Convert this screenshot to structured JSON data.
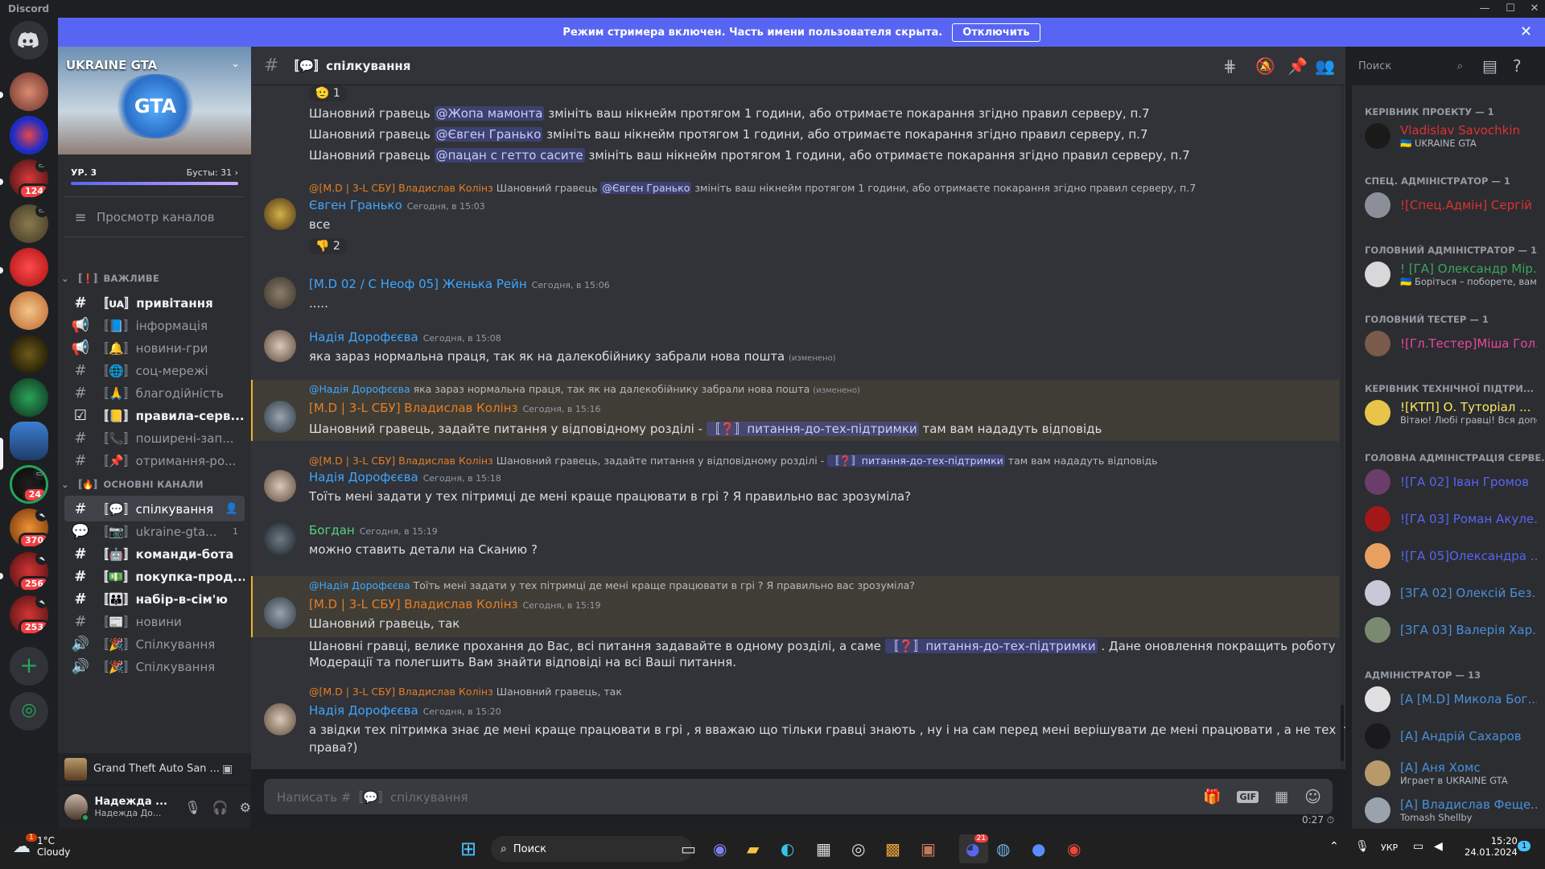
{
  "app": {
    "title": "Discord"
  },
  "banner": {
    "text": "Режим стримера включен. Часть имени пользователя скрыта.",
    "button": "Отключить"
  },
  "servers": {
    "badges": [
      "124",
      "24",
      "370",
      "256",
      "253"
    ]
  },
  "guild": {
    "name": "UKRAINE GTA",
    "level": "УР. 3",
    "boosts": "Бусты: 31",
    "browse": "Просмотр каналов"
  },
  "categories": {
    "important": "〚❗〛ВАЖЛИВЕ",
    "main": "〚🔥〛ОСНОВНІ КАНАЛИ"
  },
  "channels": [
    {
      "name": "〚ᴜᴀ〛привітання"
    },
    {
      "name": "〚📘〛інформація"
    },
    {
      "name": "〚🔔〛новини-гри"
    },
    {
      "name": "〚🌐〛соц-мережі"
    },
    {
      "name": "〚🙏〛благодійність"
    },
    {
      "name": "〚📒〛правила-серв..."
    },
    {
      "name": "〚📞〛поширені-зап..."
    },
    {
      "name": "〚📌〛отримання-ро..."
    },
    {
      "name": "〚💬〛спілкування"
    },
    {
      "name": "〚📷〛ukraine-gta...",
      "count": "1"
    },
    {
      "name": "〚🤖〛команди-бота"
    },
    {
      "name": "〚💵〛покупка-прод..."
    },
    {
      "name": "〚👪〛набір-в-сім'ю"
    },
    {
      "name": "〚📰〛новини"
    },
    {
      "name": "〚🎉〛Спілкування"
    },
    {
      "name": "〚🎉〛Спілкування"
    }
  ],
  "activity": {
    "game": "Grand Theft Auto San ..."
  },
  "user": {
    "name": "Надежда ...",
    "sub": "Надежда До..."
  },
  "header": {
    "channel": "〚💬〛спілкування",
    "search_placeholder": "Поиск"
  },
  "messages": {
    "reaction1": "🫡 1",
    "warn1": [
      "Шановний гравець",
      "@Жопа мамонта",
      "змініть ваш нікнейм протягом 1 години, або отримаєте покарання згідно правил серверу, п.7"
    ],
    "warn2": [
      "Шановний гравець",
      "@Євген Гранько",
      "змініть ваш нікнейм протягом 1 години, або отримаєте покарання згідно правил серверу, п.7"
    ],
    "warn3": [
      "Шановний гравець",
      "@пацан с гетто сасите",
      "змініть ваш нікнейм протягом 1 години, або отримаєте покарання згідно правил серверу, п.7"
    ],
    "m1": {
      "reply_author": "@[M.D | 3-L СБУ] Владислав Колінз",
      "reply_text": "Шановний гравець",
      "reply_mention": "@Євген Гранько",
      "reply_rest": "змініть ваш нікнейм протягом 1 години, або отримаєте покарання згідно правил серверу, п.7",
      "author": "Євген Гранько",
      "ts": "Сегодня, в 15:03",
      "text": "все",
      "reaction": "👎 2"
    },
    "m2": {
      "author": "[M.D 02 / С Неоф 05] Женька Рейн",
      "ts": "Сегодня, в 15:06",
      "text": "....."
    },
    "m3": {
      "author": "Надія Дорофєєва",
      "ts": "Сегодня, в 15:08",
      "text": "яка зараз нормальна праця, так як на далекобійнику забрали нова пошта",
      "edited": "(изменено)"
    },
    "m4": {
      "reply_author": "@Надія Дорофєєва",
      "reply_text": "яка зараз нормальна праця, так як на далекобійнику забрали нова пошта",
      "reply_edited": "(изменено)",
      "author": "[M.D | 3-L СБУ] Владислав Колінз",
      "ts": "Сегодня, в 15:16",
      "text": "Шановний гравець, задайте питання у відповідному розділі -",
      "channel": "〚❓〛питання-до-тех-підтримки",
      "rest": "там вам нададуть відповідь"
    },
    "m5": {
      "reply_author": "@[M.D | 3-L СБУ] Владислав Колінз",
      "reply_text": "Шановний гравець, задайте питання у відповідному розділі -",
      "reply_channel": "〚❓〛питання-до-тех-підтримки",
      "reply_rest": "там вам нададуть відповідь",
      "author": "Надія Дорофєєва",
      "ts": "Сегодня, в 15:18",
      "text": "Тоїть мені задати у тех пітримці де мені краще працювати в грі ? Я правильно вас зрозуміла?"
    },
    "m6": {
      "author": "Богдан",
      "ts": "Сегодня, в 15:19",
      "text": "можно ставить детали на Сканию ?"
    },
    "m7": {
      "reply_author": "@Надія Дорофєєва",
      "reply_text": "Тоїть мені задати у тех пітримці де мені краще працювати в грі ? Я правильно вас зрозуміла?",
      "author": "[M.D | 3-L СБУ] Владислав Колінз",
      "ts": "Сегодня, в 15:19",
      "text": "Шановний гравець, так",
      "text2a": "Шановні гравці, велике прохання до Вас, всі питання задавайте в одному розділі, а саме",
      "channel": "〚❓〛питання-до-тех-підтримки",
      "text2b": ". Дане оновлення покращить роботу",
      "text3": "Модерації та полегшить Вам знайти відповіді на всі Ваші питання."
    },
    "m8": {
      "reply_author": "@[M.D | 3-L СБУ] Владислав Колінз",
      "reply_text": "Шановний гравець, так",
      "author": "Надія Дорофєєва",
      "ts": "Сегодня, в 15:20",
      "text": "а звідки тех пітримка знає де мені краще працювати в грі , я вважаю що тільки гравці знають , ну і на сам перед мені верішувати де мені працювати , а не тех пітримка, чи я не",
      "text2": "права?)"
    }
  },
  "input": {
    "placeholder": "Написать #〚💬〛спілкування",
    "timer": "0:27"
  },
  "members": {
    "groups": [
      {
        "title": "КЕРІВНИК ПРОЕКТУ — 1",
        "items": [
          {
            "name": "Vladislav Savochkin",
            "status": "🇺🇦 UKRAINE GTA",
            "color": "#e03131"
          }
        ]
      },
      {
        "title": "СПЕЦ. АДМІНІСТРАТОР — 1",
        "items": [
          {
            "name": "![Спец.Адмін] Сергій ...",
            "status": "",
            "color": "#e03131"
          }
        ]
      },
      {
        "title": "ГОЛОВНИЙ АДМІНІСТРАТОР — 1",
        "items": [
          {
            "name": "! [ГА] Олександр Мір...",
            "status": "🇺🇦 Боріться – поборете, вам ...",
            "color": "#3ba55c"
          }
        ]
      },
      {
        "title": "ГОЛОВНИЙ ТЕСТЕР — 1",
        "items": [
          {
            "name": "![Гл.Тестер]Міша Гол...",
            "status": "",
            "color": "#eb459e"
          }
        ]
      },
      {
        "title": "КЕРІВНИК ТЕХНІЧНОЇ ПІДТРИ...",
        "items": [
          {
            "name": "![КТП] О. Туторіал ...",
            "status": "Вітаю! Любі гравці! Вся допо...",
            "color": "#fee75c"
          }
        ]
      },
      {
        "title": "ГОЛОВНА АДМІНІСТРАЦІЯ СЕРВЕ...",
        "items": [
          {
            "name": "![ГА 02] Іван Громов",
            "status": "",
            "color": "#5865f2"
          },
          {
            "name": "![ГА 03] Роман Акуле...",
            "status": "",
            "color": "#5865f2"
          },
          {
            "name": "![ГА 05]Олександра ...",
            "status": "",
            "color": "#5865f2"
          },
          {
            "name": "[ЗГА 02] Олексій Без...",
            "status": "",
            "color": "#4a90d9"
          },
          {
            "name": "[ЗГА 03] Валерія Хар...",
            "status": "",
            "color": "#4a90d9"
          }
        ]
      },
      {
        "title": "АДМІНІСТРАТОР — 13",
        "items": [
          {
            "name": "[А [M.D] Микола Бог...",
            "status": "",
            "color": "#4a90d9"
          },
          {
            "name": "[А] Андрій Сахаров",
            "status": "",
            "color": "#4a90d9"
          },
          {
            "name": "[А] Аня Хомс",
            "status": "Играет в UKRAINE GTA",
            "color": "#4a90d9"
          },
          {
            "name": "[А] Владислав Феще...",
            "status": "Tomash Shellby",
            "color": "#4a90d9"
          }
        ]
      }
    ]
  },
  "taskbar": {
    "weather_temp": "1°C",
    "weather_desc": "Cloudy",
    "weather_badge": "1",
    "search": "Поиск",
    "lang": "УКР",
    "time": "15:20",
    "date": "24.01.2024",
    "notif": "1",
    "discord_badge": "21"
  }
}
